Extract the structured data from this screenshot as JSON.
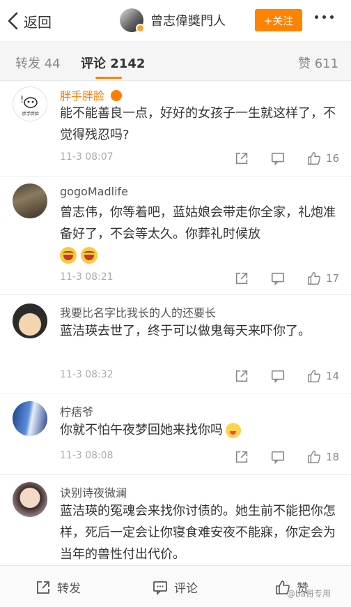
{
  "header": {
    "back_label": "返回",
    "account_name": "曾志偉獎門人",
    "follow_label": "+关注"
  },
  "tabs": [
    {
      "label": "转发",
      "count": "44"
    },
    {
      "label": "评论",
      "count": "2142"
    },
    {
      "label": "赞",
      "count": "611"
    }
  ],
  "comments": [
    {
      "name": "胖手胖脸",
      "text": "能不能善良一点，好好的女孩子一生就这样了，不觉得残忍吗?",
      "time": "11-3 08:07",
      "likes": "16"
    },
    {
      "name": "gogoMadlife",
      "text": "曾志伟，你等着吧，蓝姑娘会带走你全家，礼炮准备好了，不会等太久。你葬礼时候放",
      "time": "11-3 08:21",
      "likes": "17"
    },
    {
      "name": "我要比名字比我长的人的还要长",
      "text": "蓝洁瑛去世了，终于可以做鬼每天来吓你了。",
      "time": "11-3 08:32",
      "likes": "14"
    },
    {
      "name": "柠痞爷",
      "text": "你就不怕午夜梦回她来找你吗",
      "time": "11-3 08:08",
      "likes": "18"
    },
    {
      "name": "诀别诗夜微澜",
      "text": "蓝洁瑛的冤魂会来找你讨债的。她生前不能把你怎样，死后一定会让你寝食难安夜不能寐，你定会为当年的兽性付出代价。",
      "time": "",
      "likes": ""
    }
  ],
  "avatar_badge_text": "胖手胖脸",
  "bottom_bar": {
    "repost_label": "转发",
    "comment_label": "评论",
    "like_label": "赞"
  },
  "watermark": "@ba哥专用",
  "colors": {
    "accent": "#ff8200",
    "vip_name": "#ff7e00",
    "background": "#ffffff"
  }
}
